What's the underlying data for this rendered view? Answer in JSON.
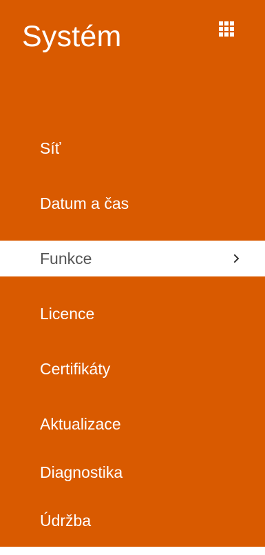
{
  "header": {
    "title": "Systém",
    "menu_icon": "apps-grid-icon"
  },
  "nav": {
    "items": [
      {
        "label": "Síť",
        "active": false
      },
      {
        "label": "Datum a čas",
        "active": false
      },
      {
        "label": "Funkce",
        "active": true,
        "icon": "chevron-right-icon"
      },
      {
        "label": "Licence",
        "active": false
      },
      {
        "label": "Certifikáty",
        "active": false
      },
      {
        "label": "Aktualizace",
        "active": false
      },
      {
        "label": "Diagnostika",
        "active": false
      },
      {
        "label": "Údržba",
        "active": false
      }
    ]
  },
  "colors": {
    "sidebar_bg": "#d95a00",
    "active_bg": "#ffffff",
    "active_text": "#555555",
    "text": "#ffffff"
  }
}
